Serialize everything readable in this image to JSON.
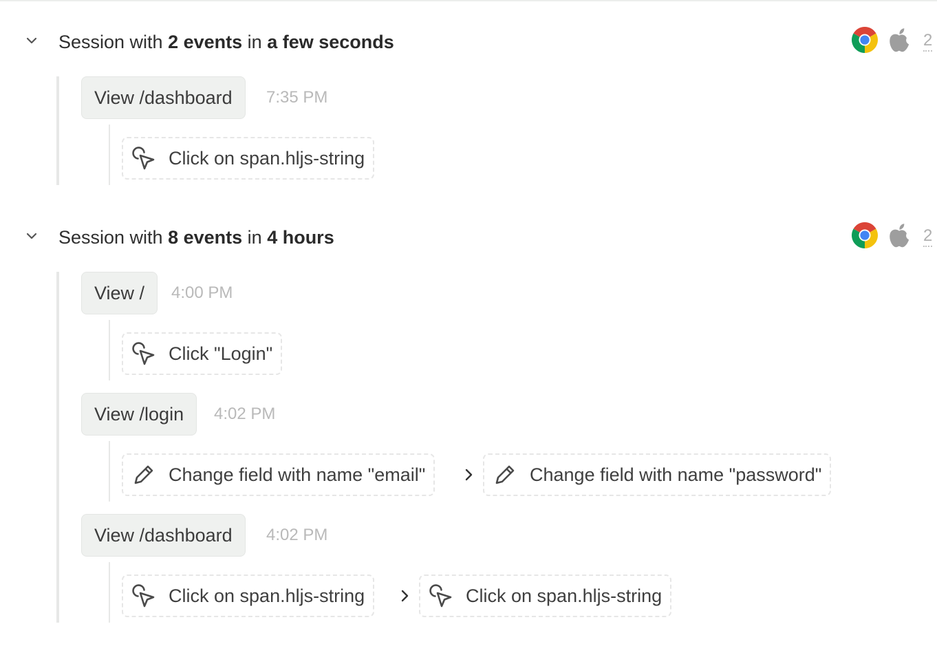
{
  "sessions": [
    {
      "title": {
        "prefix": "Session with ",
        "events": "2 events",
        "mid": " in ",
        "duration": "a few seconds"
      },
      "browser_icon": "chrome-icon",
      "os_icon": "apple-icon",
      "overflow": "2",
      "pages": [
        {
          "label": "View /dashboard",
          "time": "7:35 PM",
          "events": [
            {
              "type": "click",
              "icon": "cursor-click-icon",
              "label": "Click on span.hljs-string"
            }
          ]
        }
      ]
    },
    {
      "title": {
        "prefix": "Session with ",
        "events": "8 events",
        "mid": " in ",
        "duration": "4 hours"
      },
      "browser_icon": "chrome-icon",
      "os_icon": "apple-icon",
      "overflow": "2",
      "pages": [
        {
          "label": "View /",
          "time": "4:00 PM",
          "events": [
            {
              "type": "click",
              "icon": "cursor-click-icon",
              "label": "Click \"Login\""
            }
          ]
        },
        {
          "label": "View /login",
          "time": "4:02 PM",
          "events": [
            {
              "type": "change",
              "icon": "pencil-icon",
              "label": "Change field with name \"email\""
            },
            {
              "type": "change",
              "icon": "pencil-icon",
              "label": "Change field with name \"password\""
            }
          ]
        },
        {
          "label": "View /dashboard",
          "time": "4:02 PM",
          "events": [
            {
              "type": "click",
              "icon": "cursor-click-icon",
              "label": "Click on span.hljs-string"
            },
            {
              "type": "click",
              "icon": "cursor-click-icon",
              "label": "Click on span.hljs-string"
            }
          ]
        }
      ]
    }
  ],
  "colors": {
    "rail": "#e7e8e7",
    "view_pill_bg": "#eff1ef",
    "event_border": "#e6e6e6",
    "time_text": "#b9b9b9",
    "chrome_red": "#db4437",
    "chrome_yellow": "#f4c20d",
    "chrome_green": "#0f9d58",
    "chrome_blue": "#4285f4",
    "apple_gray": "#9e9e9e"
  }
}
